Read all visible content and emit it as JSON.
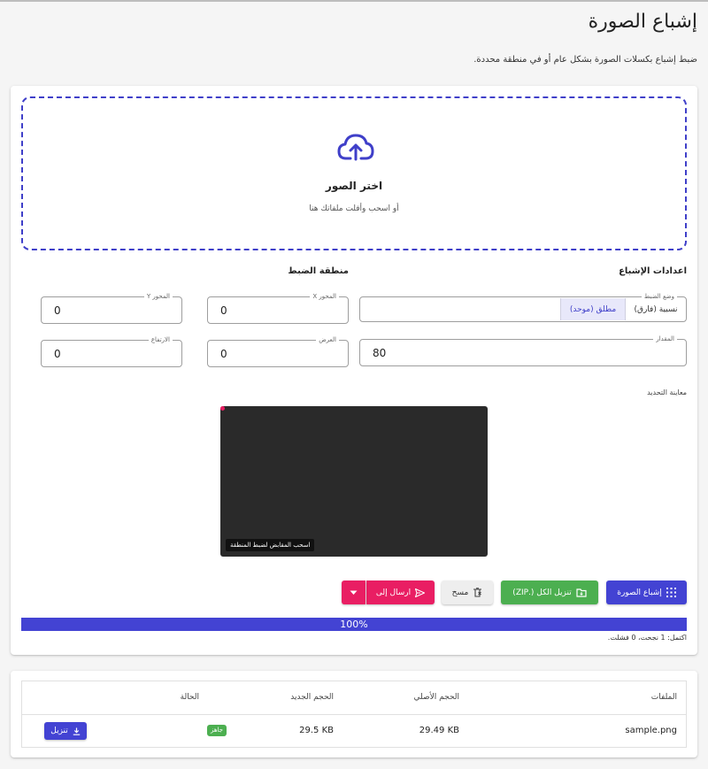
{
  "header": {
    "title": "إشباع الصورة",
    "description": "ضبط إشباع بكسلات الصورة بشكل عام أو في منطقة محددة."
  },
  "dropzone": {
    "title": "اختر الصور",
    "subtitle": "أو اسحب وأفلت ملفاتك هنا",
    "icon": "cloud-upload-icon"
  },
  "settings": {
    "title": "اعدادات الإشباع",
    "mode_label": "وضع الضبط",
    "mode_options": [
      "نسبية (فارق)",
      "مطلق (موحد)"
    ],
    "amount_label": "المقدار",
    "amount_value": "80"
  },
  "region": {
    "title": "منطقة الضبط",
    "x_label": "المحور X",
    "x_value": "0",
    "y_label": "المحور Y",
    "y_value": "0",
    "width_label": "العرض",
    "width_value": "0",
    "height_label": "الارتفاع",
    "height_value": "0"
  },
  "preview": {
    "label": "معاينة التحديد",
    "hint": "اسحب المقابض لضبط المنطقة"
  },
  "actions": {
    "saturate": "إشباع الصورة",
    "download_all": "تنزيل الكل (.ZIP)",
    "clear": "مسح",
    "send_to": "ارسال إلى"
  },
  "progress": {
    "value": 100,
    "text": "100%",
    "status": "اكتمل: 1 نجحت، 0 فشلت."
  },
  "files_table": {
    "headers": {
      "file": "الملفات",
      "original_size": "الحجم الأصلي",
      "new_size": "الحجم الجديد",
      "status": "الحالة"
    },
    "rows": [
      {
        "name": "sample.png",
        "original_size": "29.49 KB",
        "new_size": "29.5 KB",
        "status": "جاهز",
        "action": "تنزيل"
      }
    ]
  },
  "colors": {
    "accent": "#4343d3",
    "success": "#4caf50",
    "pink": "#e91e63"
  }
}
